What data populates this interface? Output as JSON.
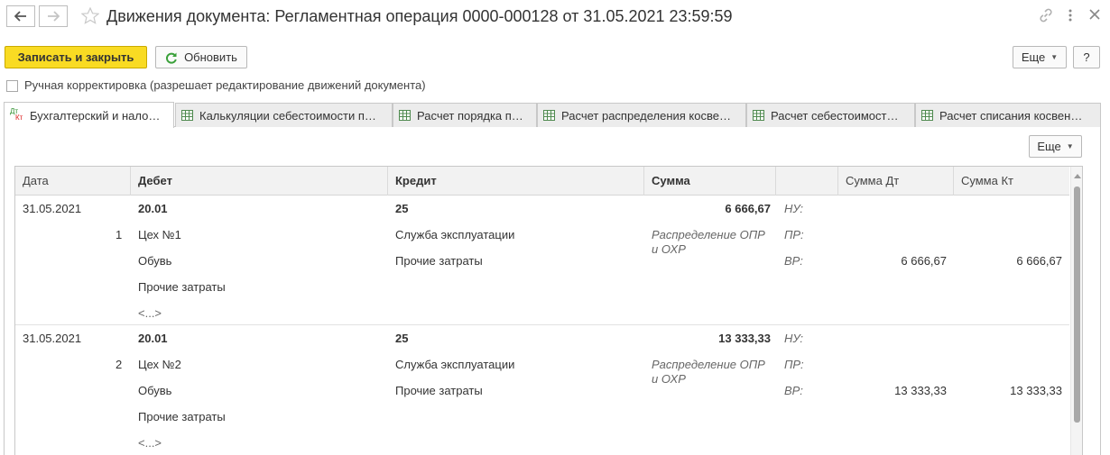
{
  "header": {
    "title": "Движения документа: Регламентная операция 0000-000128 от 31.05.2021 23:59:59"
  },
  "toolbar": {
    "save_close_label": "Записать и закрыть",
    "refresh_label": "Обновить",
    "more_label": "Еще",
    "help_label": "?"
  },
  "manual_adjust": {
    "label": "Ручная корректировка (разрешает редактирование движений документа)",
    "checked": false
  },
  "tabs": [
    {
      "label": "Бухгалтерский и нало…",
      "icon": "dt-kt-icon",
      "active": true
    },
    {
      "label": "Калькуляции себестоимости п…",
      "icon": "table-icon",
      "active": false
    },
    {
      "label": "Расчет порядка п…",
      "icon": "table-icon",
      "active": false
    },
    {
      "label": "Расчет распределения косве…",
      "icon": "table-icon",
      "active": false
    },
    {
      "label": "Расчет себестоимост…",
      "icon": "table-icon",
      "active": false
    },
    {
      "label": "Расчет списания косвен…",
      "icon": "table-icon",
      "active": false
    }
  ],
  "panel": {
    "more_label": "Еще"
  },
  "table": {
    "columns": [
      "Дата",
      "Дебет",
      "Кредит",
      "Сумма",
      "",
      "Сумма Дт",
      "Сумма Кт"
    ],
    "rows": [
      {
        "date": "31.05.2021",
        "num": "1",
        "debit": [
          "20.01",
          "Цех №1",
          "Обувь",
          "Прочие затраты",
          "<...>"
        ],
        "credit": [
          "25",
          "Служба эксплуатации",
          "Прочие затраты"
        ],
        "sum": "6 666,67",
        "content": "Распределение ОПР и ОХР",
        "types": [
          "НУ:",
          "ПР:",
          "ВР:"
        ],
        "sum_dt": "6 666,67",
        "sum_kt": "6 666,67"
      },
      {
        "date": "31.05.2021",
        "num": "2",
        "debit": [
          "20.01",
          "Цех №2",
          "Обувь",
          "Прочие затраты",
          "<...>"
        ],
        "credit": [
          "25",
          "Служба эксплуатации",
          "Прочие затраты"
        ],
        "sum": "13 333,33",
        "content": "Распределение ОПР и ОХР",
        "types": [
          "НУ:",
          "ПР:",
          "ВР:"
        ],
        "sum_dt": "13 333,33",
        "sum_kt": "13 333,33"
      }
    ]
  },
  "colors": {
    "primary_button": "#f9db23",
    "refresh_icon": "#3aa03a"
  }
}
